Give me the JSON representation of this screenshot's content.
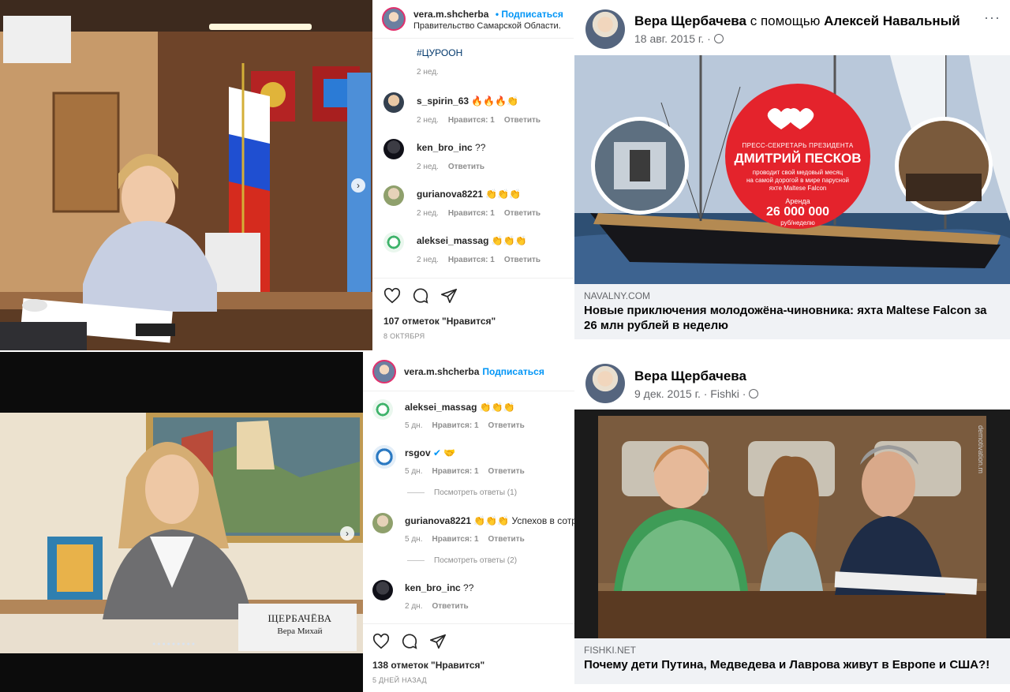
{
  "colors": {
    "ig_blue": "#0095f6",
    "fb_grey": "#65676b",
    "fb_linkbox": "#f0f2f5"
  },
  "ig_top": {
    "username": "vera.m.shcherba",
    "follow": "• Подписаться",
    "location": "Правительство Самарской Области.",
    "hashtag": "#ЦУРООН",
    "hashtag_time": "2 нед.",
    "comments": [
      {
        "user": "s_spirin_63",
        "text": "🔥🔥🔥👏",
        "time": "2 нед.",
        "likes": "Нравится: 1",
        "reply": "Ответить"
      },
      {
        "user": "ken_bro_inc",
        "text": "??",
        "time": "2 нед.",
        "likes": "",
        "reply": "Ответить"
      },
      {
        "user": "gurianova8221",
        "text": "👏👏👏",
        "time": "2 нед.",
        "likes": "Нравится: 1",
        "reply": "Ответить"
      },
      {
        "user": "aleksei_massag",
        "text": "👏👏👏",
        "time": "2 нед.",
        "likes": "Нравится: 1",
        "reply": "Ответить"
      }
    ],
    "likes": "107 отметок \"Нравится\"",
    "date": "8 ОКТЯБРЯ"
  },
  "ig_bottom": {
    "username": "vera.m.shcherba",
    "follow": "Подписаться",
    "comments": [
      {
        "user": "aleksei_massag",
        "text": "👏👏👏",
        "time": "5 дн.",
        "likes": "Нравится: 1",
        "reply": "Ответить"
      },
      {
        "user": "rsgov",
        "text": "✔ 🤝",
        "time": "5 дн.",
        "likes": "Нравится: 1",
        "reply": "Ответить",
        "replies": "Посмотреть ответы (1)"
      },
      {
        "user": "gurianova8221",
        "text": "👏👏👏  Успехов в сотруд",
        "time": "5 дн.",
        "likes": "Нравится: 1",
        "reply": "Ответить",
        "replies": "Посмотреть ответы (2)"
      },
      {
        "user": "ken_bro_inc",
        "text": "??",
        "time": "2 дн.",
        "likes": "",
        "reply": "Ответить"
      }
    ],
    "likes": "138 отметок \"Нравится\"",
    "date": "5 ДНЕЙ НАЗАД",
    "nameplate_line1": "ЩЕРБАЧЁВА",
    "nameplate_line2": "Вера Михай"
  },
  "fb_top": {
    "author": "Вера Щербачева",
    "with_text": "с помощью",
    "with_name": "Алексей Навальный",
    "time": "18 авг. 2015 г. ·",
    "dots": "···",
    "domain": "NAVALNY.COM",
    "headline": "Новые приключения молодожёна-чиновника: яхта Maltese Falcon за 26 млн рублей в неделю",
    "circle": {
      "role": "ПРЕСС-СЕКРЕТАРЬ ПРЕЗИДЕНТА",
      "name": "ДМИТРИЙ ПЕСКОВ",
      "desc1": "проводит свой медовый месяц",
      "desc2": "на самой дорогой в мире парусной",
      "desc3": "яхте Maltese Falcon",
      "rent": "Аренда",
      "price": "26 000 000",
      "unit": "руб/неделю"
    }
  },
  "fb_bottom": {
    "author": "Вера Щербачева",
    "time": "9 дек. 2015 г. · Fishki ·",
    "domain": "FISHKI.NET",
    "headline": "Почему дети Путина, Медведева и Лаврова живут в Европе и США?!",
    "watermark": "demotivation.m"
  }
}
